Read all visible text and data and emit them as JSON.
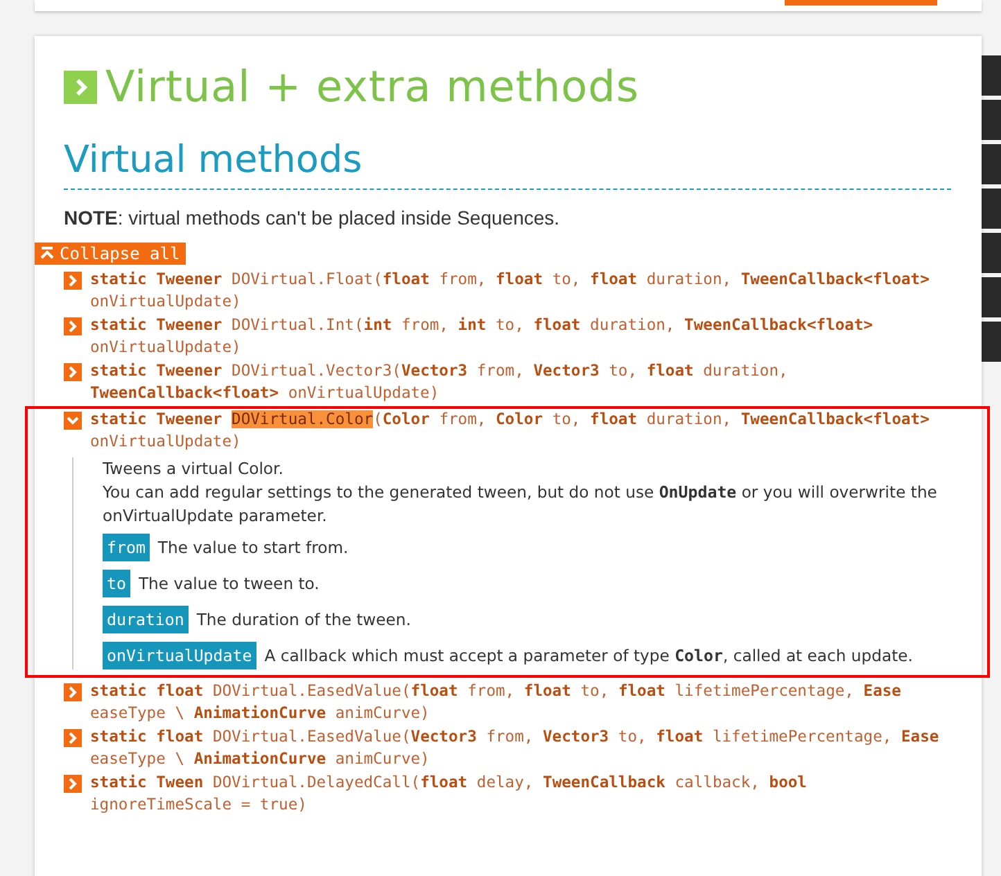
{
  "title": "Virtual + extra methods",
  "section": {
    "title": "Virtual methods",
    "note": "**NOTE**: virtual methods can't be placed inside Sequences.",
    "collapse_button": "Collapse all"
  },
  "methods": [
    {
      "returns": "static Tweener",
      "name": "DOVirtual.Float",
      "params": "(**float** from, **float** to, **float** duration, **TweenCallback<float>** onVirtualUpdate)",
      "expanded": false,
      "highlighted": false,
      "name_highlighted": false
    },
    {
      "returns": "static Tweener",
      "name": "DOVirtual.Int",
      "params": "(**int** from, **int** to, **float** duration, **TweenCallback<float>** onVirtualUpdate)",
      "expanded": false,
      "highlighted": false,
      "name_highlighted": false
    },
    {
      "returns": "static Tweener",
      "name": "DOVirtual.Vector3",
      "params": "(**Vector3** from, **Vector3** to, **float** duration, **TweenCallback<float>** onVirtualUpdate)",
      "expanded": false,
      "highlighted": false,
      "name_highlighted": false
    },
    {
      "returns": "static Tweener",
      "name": "DOVirtual.Color",
      "params": "(**Color** from, **Color** to, **float** duration, **TweenCallback<float>** onVirtualUpdate)",
      "expanded": true,
      "highlighted": true,
      "name_highlighted": true,
      "description": [
        "Tweens a virtual Color.",
        "You can add regular settings to the generated tween, but do not use **OnUpdate** or you will overwrite the onVirtualUpdate parameter."
      ],
      "parameters": [
        {
          "name": "from",
          "text": "The value to start from."
        },
        {
          "name": "to",
          "text": "The value to tween to."
        },
        {
          "name": "duration",
          "text": "The duration of the tween."
        },
        {
          "name": "onVirtualUpdate",
          "text": "A callback which must accept a parameter of type **Color**, called at each update."
        }
      ]
    },
    {
      "returns": "static float",
      "name": "DOVirtual.EasedValue",
      "params": "(**float** from, **float** to, **float** lifetimePercentage, **Ease** easeType \\ **AnimationCurve** animCurve)",
      "expanded": false,
      "highlighted": false,
      "name_highlighted": false
    },
    {
      "returns": "static float",
      "name": "DOVirtual.EasedValue",
      "params": "(**Vector3** from, **Vector3** to, **float** lifetimePercentage, **Ease** easeType \\ **AnimationCurve** animCurve)",
      "expanded": false,
      "highlighted": false,
      "name_highlighted": false
    },
    {
      "returns": "static Tween",
      "name": "DOVirtual.DelayedCall",
      "params": "(**float** delay, **TweenCallback** callback, **bool** ignoreTimeScale = true)",
      "expanded": false,
      "highlighted": false,
      "name_highlighted": false
    }
  ]
}
